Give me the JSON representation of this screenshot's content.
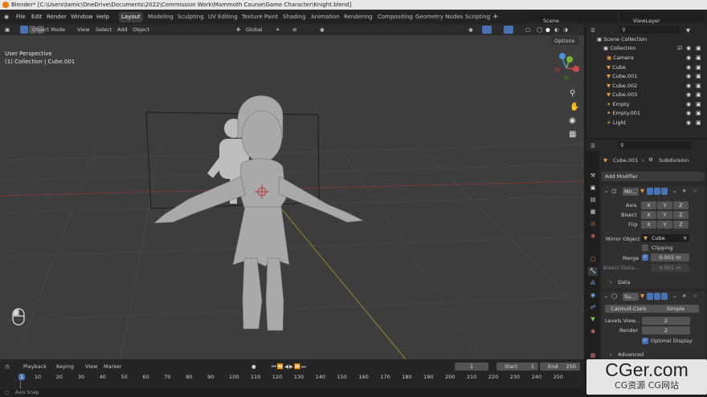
{
  "window": {
    "title": "Blender* [C:\\Users\\tamic\\OneDrive\\Documents\\2022\\Commission Work\\Mammoth Course\\Game Character\\Knight.blend]"
  },
  "menu": [
    "File",
    "Edit",
    "Render",
    "Window",
    "Help"
  ],
  "workspaces": [
    "Layout",
    "Modeling",
    "Sculpting",
    "UV Editing",
    "Texture Paint",
    "Shading",
    "Animation",
    "Rendering",
    "Compositing",
    "Geometry Nodes",
    "Scripting"
  ],
  "active_workspace": "Layout",
  "scene": "Scene",
  "view_layer": "ViewLayer",
  "viewport": {
    "mode": "Object Mode",
    "menus": [
      "View",
      "Select",
      "Add",
      "Object"
    ],
    "orientation": "Global",
    "options": "Options",
    "overlay_title": "User Perspective",
    "overlay_sub": "(1) Collection | Cube.001",
    "gizmo": {
      "x": "X",
      "y": "Y",
      "z": "Z"
    }
  },
  "outliner": {
    "root": "Scene Collection",
    "collection": "Collection",
    "items": [
      "Camera",
      "Cube",
      "Cube.001",
      "Cube.002",
      "Cube.003",
      "Empty",
      "Empty.001",
      "Light"
    ]
  },
  "properties": {
    "object": "Cube.001",
    "modifier_ref": "Subdivision",
    "add_modifier": "Add Modifier",
    "mirror": {
      "name": "Mir...",
      "axis_label": "Axis",
      "bisect_label": "Bisect",
      "flip_label": "Flip",
      "axes": [
        "X",
        "Y",
        "Z"
      ],
      "mirror_object_label": "Mirror Object",
      "mirror_object": "Cube",
      "clipping": "Clipping",
      "merge_label": "Merge",
      "merge": "0.001 m",
      "bisect_dist_label": "Bisect Dista...",
      "bisect_dist": "0.001 m",
      "data": "Data"
    },
    "subsurf": {
      "name": "Su...",
      "catmull": "Catmull-Clark",
      "simple": "Simple",
      "levels_label": "Levels View...",
      "levels": "2",
      "render_label": "Render",
      "render": "2",
      "optimal": "Optimal Display",
      "advanced": "Advanced"
    }
  },
  "timeline": {
    "menus": [
      "Playback",
      "Keying",
      "View",
      "Marker"
    ],
    "current": "1",
    "start_label": "Start",
    "start": "1",
    "end_label": "End",
    "end": "250",
    "ticks": [
      "1",
      "10",
      "20",
      "30",
      "40",
      "50",
      "60",
      "70",
      "80",
      "90",
      "100",
      "110",
      "120",
      "130",
      "140",
      "150",
      "160",
      "170",
      "180",
      "190",
      "200",
      "210",
      "220",
      "230",
      "240",
      "250"
    ]
  },
  "status": {
    "hint": "Axis Snap"
  },
  "watermark": {
    "site": "CGer.com",
    "sub": "CG资源 CG网站"
  }
}
